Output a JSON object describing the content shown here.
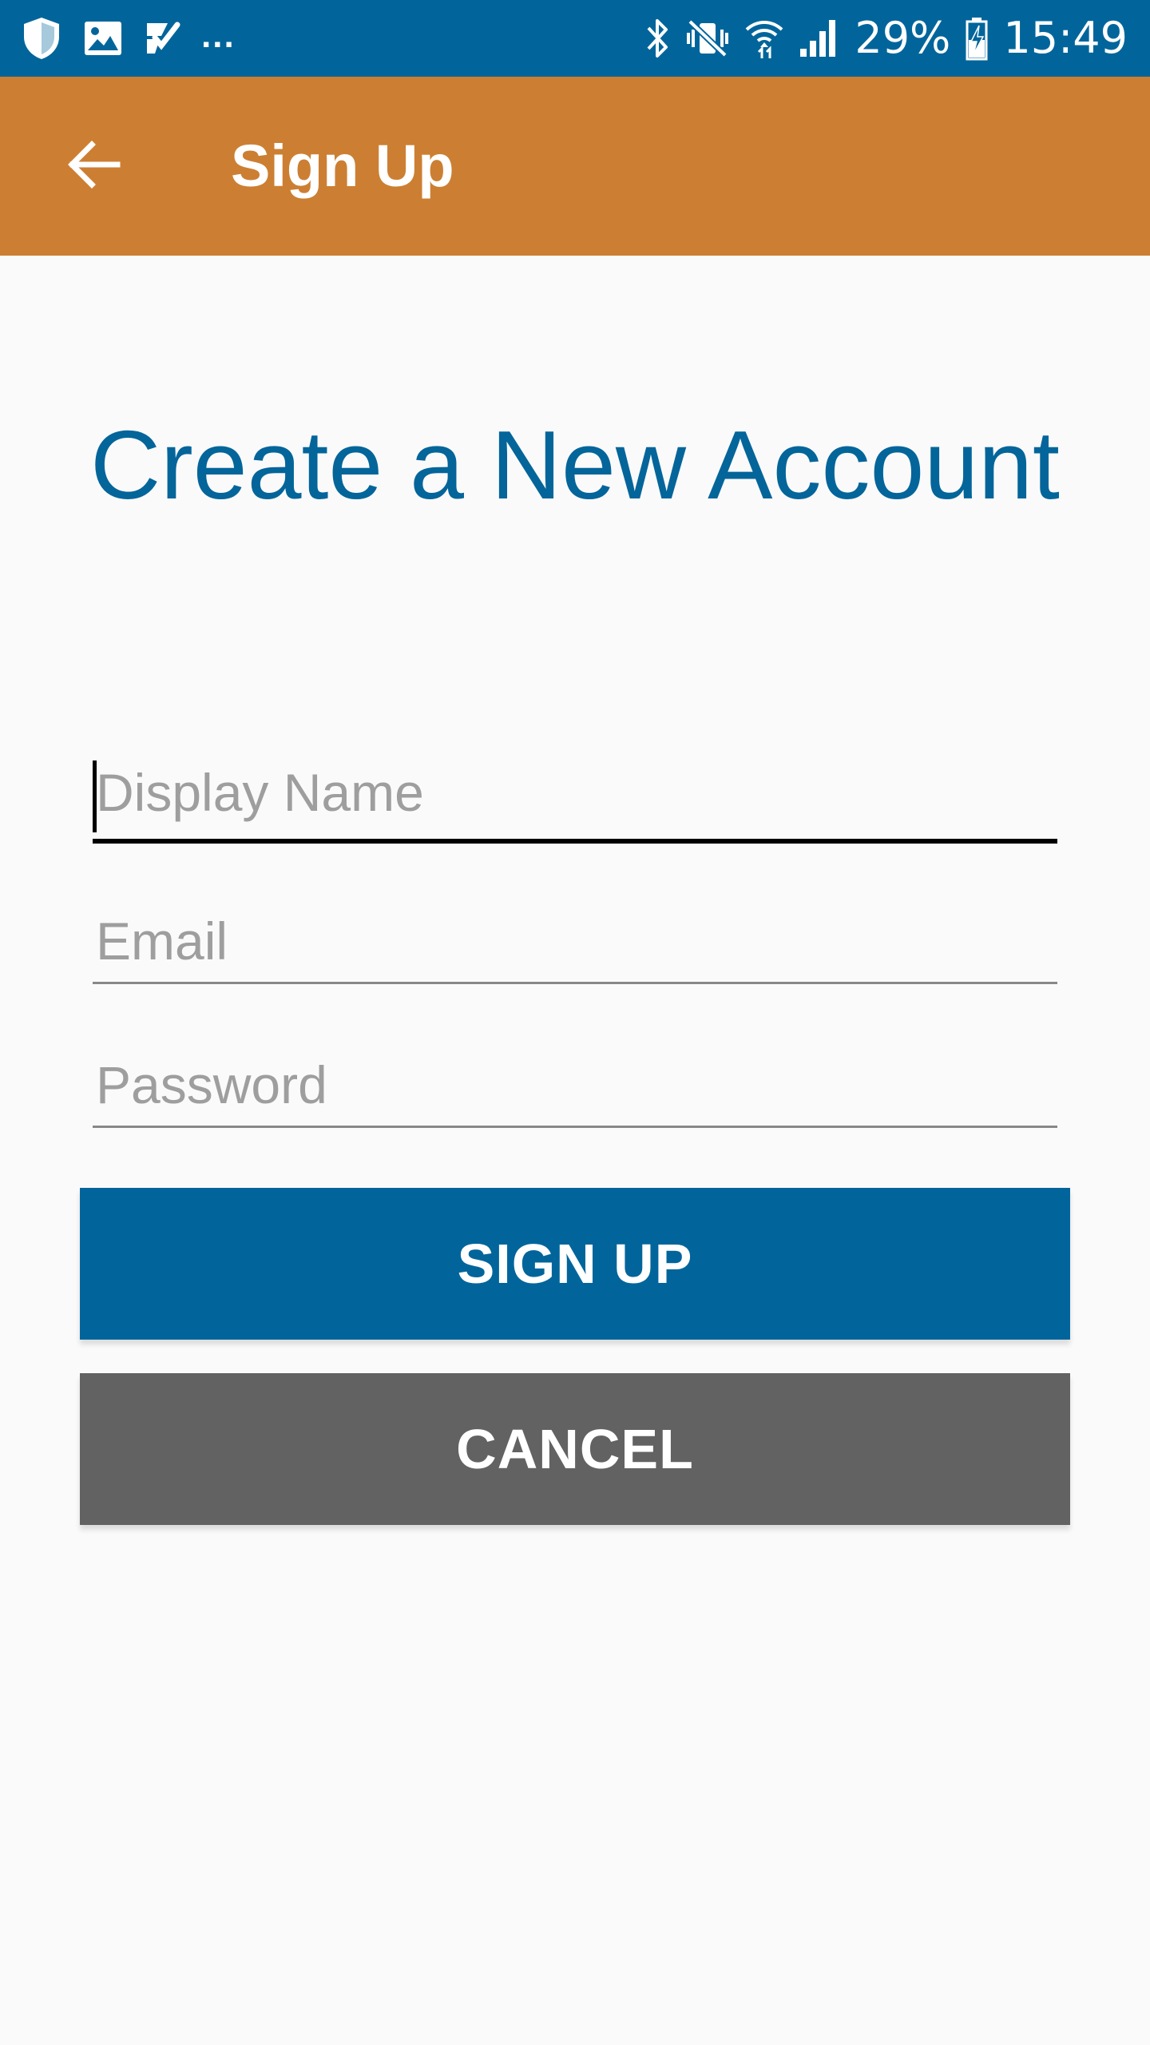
{
  "status_bar": {
    "battery_percent": "29%",
    "time": "15:49",
    "overflow_dots": "...",
    "icons_left": [
      "shield-icon",
      "image-icon",
      "checklist-icon"
    ],
    "icons_right": [
      "bluetooth-icon",
      "vibrate-mute-icon",
      "wifi-icon",
      "signal-icon",
      "battery-charging-icon"
    ],
    "background_color": "#01659b"
  },
  "app_bar": {
    "title": "Sign Up",
    "back_icon": "arrow-back-icon",
    "background_color": "#cc7f32"
  },
  "main": {
    "heading": "Create a New Account",
    "heading_color": "#03659a",
    "fields": {
      "display_name": {
        "placeholder": "Display Name",
        "value": ""
      },
      "email": {
        "placeholder": "Email",
        "value": ""
      },
      "password": {
        "placeholder": "Password",
        "value": ""
      }
    },
    "buttons": {
      "sign_up": "SIGN UP",
      "cancel": "CANCEL"
    },
    "colors": {
      "sign_up_button": "#01659b",
      "cancel_button": "#626262"
    }
  }
}
